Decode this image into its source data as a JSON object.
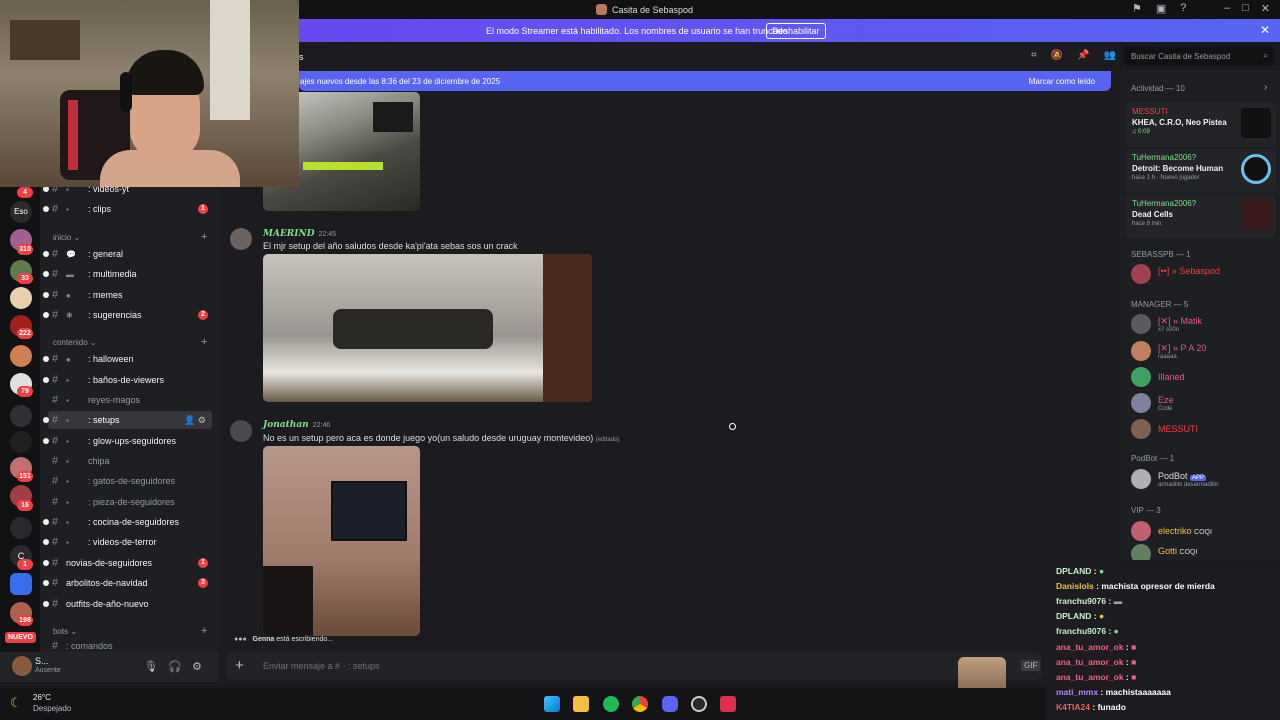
{
  "window": {
    "title": "Casita de Sebaspod"
  },
  "streamer_banner": {
    "message": "El modo Streamer está habilitado. Los nombres de usuario se han truncado.",
    "button": "Deshabilitar"
  },
  "channel_header": {
    "name_fragment": "s"
  },
  "search": {
    "placeholder": "Buscar Casita de Sebaspod"
  },
  "new_messages_bar": {
    "text": "ajes nuevos desde las 8:36 del 23 de diciembre de 2025",
    "mark_read": "Marcar como leído"
  },
  "guild_badges": [
    "4",
    "Eso",
    "310",
    "33",
    "222",
    "79",
    "151",
    "16",
    "C",
    "1",
    "198"
  ],
  "guild_new_label": "NUEVO",
  "channels": {
    "top": [
      {
        "name": ": videos-yt",
        "badge": ""
      },
      {
        "name": ": clips",
        "badge": "1"
      }
    ],
    "cat_inicio": "inicio",
    "inicio": [
      {
        "name": ": general",
        "badge": ""
      },
      {
        "name": ": multimedia",
        "badge": ""
      },
      {
        "name": ": memes",
        "badge": ""
      },
      {
        "name": ": sugerencias",
        "badge": "2"
      }
    ],
    "cat_contenido": "contenido",
    "contenido": [
      {
        "name": ": halloween",
        "badge": ""
      },
      {
        "name": ": baños-de-viewers",
        "badge": ""
      },
      {
        "name": "reyes-magos",
        "badge": ""
      },
      {
        "name": ": setups",
        "badge": ""
      },
      {
        "name": ": glow-ups-seguidores",
        "badge": ""
      },
      {
        "name": "chipa",
        "badge": ""
      },
      {
        "name": ": gatos-de-seguidores",
        "badge": ""
      },
      {
        "name": ": pieza-de-seguidores",
        "badge": ""
      },
      {
        "name": ": cocina-de-seguidores",
        "badge": ""
      },
      {
        "name": ": videos-de-terror",
        "badge": ""
      },
      {
        "name": "novias-de-seguidores",
        "badge": "1"
      },
      {
        "name": "arbolitos-de-navidad",
        "badge": "3"
      },
      {
        "name": "outfits-de-año-nuevo",
        "badge": ""
      }
    ],
    "cat_bots": "bots",
    "bots_partial": ": comandos"
  },
  "user_panel": {
    "name": "S...",
    "status": "Ausente"
  },
  "messages": [
    {
      "user": "MAERIND",
      "time": "22:45",
      "text": "El mjr setup del año saludos desde ka'pi'ata sebas sos un crack"
    },
    {
      "user": "Jonathan",
      "time": "22:46",
      "text": "No es un setup pero aca es donde juego yo(un saludo desde uruguay montevideo)",
      "edited": "(editado)"
    }
  ],
  "typing": {
    "user": "Genna",
    "text": " está escribiendo..."
  },
  "composer": {
    "placeholder": "Enviar mensaje a #  ·  : setups",
    "gif": "GIF"
  },
  "activity": {
    "title": "Actividad — 10",
    "items": [
      {
        "user": "MESSUTI",
        "game": "KHEA, C.R.O, Neo Pistea",
        "sub": "♫ 0:09",
        "red": true
      },
      {
        "user": "TuHermana2006?",
        "game": "Detroit: Become Human",
        "sub": "hace 1 h  · Nuevo jugador",
        "red": false
      },
      {
        "user": "TuHermana2006?",
        "game": "Dead Cells",
        "sub": "hace 8 min",
        "red": false
      }
    ]
  },
  "member_groups": [
    {
      "label": "SEBASSPB — 1",
      "members": [
        {
          "name": "[••] » Sebaspod",
          "sub": "",
          "color": "#f23f43"
        }
      ]
    },
    {
      "label": "MANAGER — 5",
      "members": [
        {
          "name": "[✕] » Matik",
          "sub": "x7 s00n",
          "color": "#e4558a"
        },
        {
          "name": "[✕] » P A 20",
          "sub": "raaaaa",
          "color": "#e4558a"
        },
        {
          "name": "Illaned",
          "sub": "",
          "color": "#e4558a"
        },
        {
          "name": "Eze",
          "sub": "Code",
          "color": "#e4558a"
        },
        {
          "name": "MESSUTI",
          "sub": "",
          "color": "#f23f43"
        }
      ]
    },
    {
      "label": "PodBot — 1",
      "members": [
        {
          "name": "PodBot",
          "sub": "armadillo desarmadillo",
          "color": "#dbdee1",
          "app": "APP"
        }
      ]
    },
    {
      "label": "VIP — 3",
      "members": [
        {
          "name": "electriko",
          "sub": "",
          "color": "#f0c040",
          "tag": "COQI"
        },
        {
          "name": "Gotti",
          "sub": "",
          "color": "#f0c040",
          "tag": "COQI"
        }
      ]
    }
  ],
  "stream_chat": [
    {
      "name": "DPLAND",
      "msg": ""
    },
    {
      "name": "Danislols",
      "msg": "machista opresor de mierda"
    },
    {
      "name": "franchu9076",
      "msg": ""
    },
    {
      "name": "DPLAND",
      "msg": ""
    },
    {
      "name": "franchu9076",
      "msg": ""
    },
    {
      "name": "ana_tu_amor_ok",
      "msg": ""
    },
    {
      "name": "ana_tu_amor_ok",
      "msg": ""
    },
    {
      "name": "ana_tu_amor_ok",
      "msg": ""
    },
    {
      "name": "mati_mmx",
      "msg": "machistaaaaaaa"
    },
    {
      "name": "K4TIA24",
      "msg": "funado"
    }
  ],
  "weather": {
    "temp": "26°C",
    "condition": "Despejado"
  },
  "colors": {
    "accent": "#5865f2",
    "streamer_banner": "#6c3ff0",
    "badge": "#f23f43"
  }
}
